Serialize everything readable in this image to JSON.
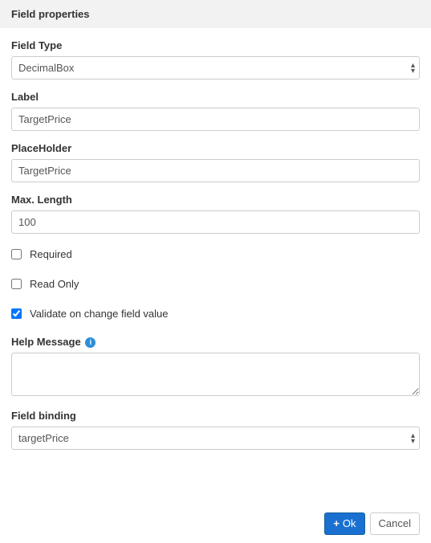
{
  "header": {
    "title": "Field properties"
  },
  "form": {
    "fieldType": {
      "label": "Field Type",
      "value": "DecimalBox"
    },
    "label": {
      "label": "Label",
      "value": "TargetPrice"
    },
    "placeholder": {
      "label": "PlaceHolder",
      "value": "TargetPrice"
    },
    "maxLength": {
      "label": "Max. Length",
      "value": "100"
    },
    "required": {
      "label": "Required",
      "checked": false
    },
    "readOnly": {
      "label": "Read Only",
      "checked": false
    },
    "validateOnChange": {
      "label": "Validate on change field value",
      "checked": true
    },
    "helpMessage": {
      "label": "Help Message",
      "value": ""
    },
    "fieldBinding": {
      "label": "Field binding",
      "value": "targetPrice"
    }
  },
  "buttons": {
    "ok": "Ok",
    "cancel": "Cancel"
  }
}
